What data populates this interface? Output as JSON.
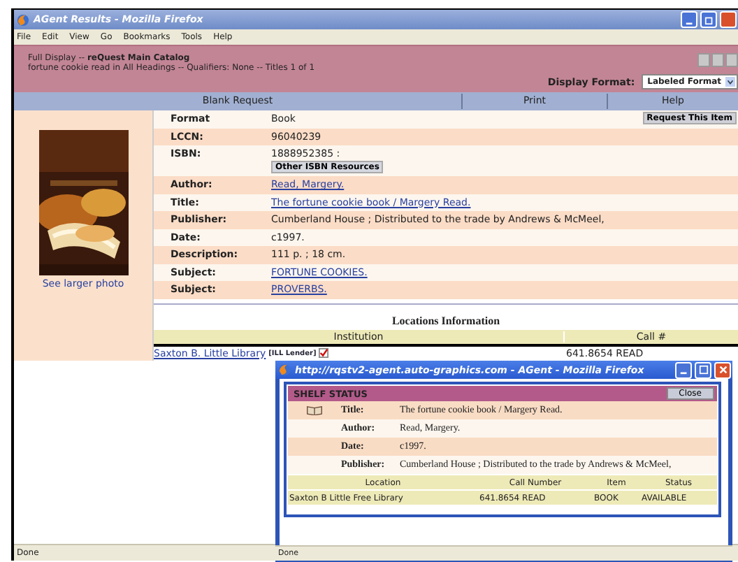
{
  "window": {
    "title": "AGent Results - Mozilla Firefox",
    "status": "Done"
  },
  "menu": [
    "File",
    "Edit",
    "View",
    "Go",
    "Bookmarks",
    "Tools",
    "Help"
  ],
  "header": {
    "heading": "Full Display -- **reQuest Main Catalog**",
    "query": "fortune cookie read in All Headings -- Qualifiers: None -- Titles 1 of 1",
    "format_label": "Display Format:",
    "format_value": "Labeled Format"
  },
  "nav": [
    "Blank Request",
    "Print",
    "Help"
  ],
  "cover": {
    "kind": "picture",
    "link": "See larger photo"
  },
  "record": {
    "request_button": "Request This Item",
    "fields": [
      {
        "label": "Format",
        "value": "Book",
        "kind": "text"
      },
      {
        "label": "LCCN:",
        "value": "96040239",
        "kind": "text"
      },
      {
        "label": "ISBN:",
        "value": "1888952385 :",
        "kind": "text",
        "button": "Other ISBN Resources"
      },
      {
        "label": "Author:",
        "value": "Read, Margery.",
        "kind": "link"
      },
      {
        "label": "Title:",
        "value": "The fortune cookie book / Margery Read.",
        "kind": "link"
      },
      {
        "label": "Publisher:",
        "value": "Cumberland House ; Distributed to the trade by Andrews & McMeel,",
        "kind": "text"
      },
      {
        "label": "Date:",
        "value": "c1997.",
        "kind": "text"
      },
      {
        "label": "Description:",
        "value": "111 p. ; 18 cm.",
        "kind": "text"
      },
      {
        "label": "Subject:",
        "value": "FORTUNE COOKIES.",
        "kind": "link"
      },
      {
        "label": "Subject:",
        "value": "PROVERBS.",
        "kind": "link"
      }
    ]
  },
  "locations": {
    "title": "Locations Information",
    "columns": [
      "Institution",
      "Call #"
    ],
    "rows": [
      {
        "institution": "Saxton B. Little Library",
        "tag": "[ILL Lender]",
        "call_number": "641.8654 READ"
      }
    ]
  },
  "popup": {
    "title": "http://rqstv2-agent.auto-graphics.com - AGent - Mozilla Firefox",
    "heading": "SHELF STATUS",
    "close": "Close",
    "fields": [
      {
        "label": "Title:",
        "value": "The fortune cookie book / Margery Read."
      },
      {
        "label": "Author:",
        "value": "Read, Margery."
      },
      {
        "label": "Date:",
        "value": "c1997."
      },
      {
        "label": "Publisher:",
        "value": "Cumberland House ; Distributed to the trade by Andrews & McMeel,"
      }
    ],
    "columns": [
      "Location",
      "Call Number",
      "Item",
      "Status"
    ],
    "rows": [
      [
        "Saxton B Little Free Library",
        "641.8654 READ",
        "BOOK",
        "AVAILABLE"
      ]
    ],
    "status": "Done"
  }
}
